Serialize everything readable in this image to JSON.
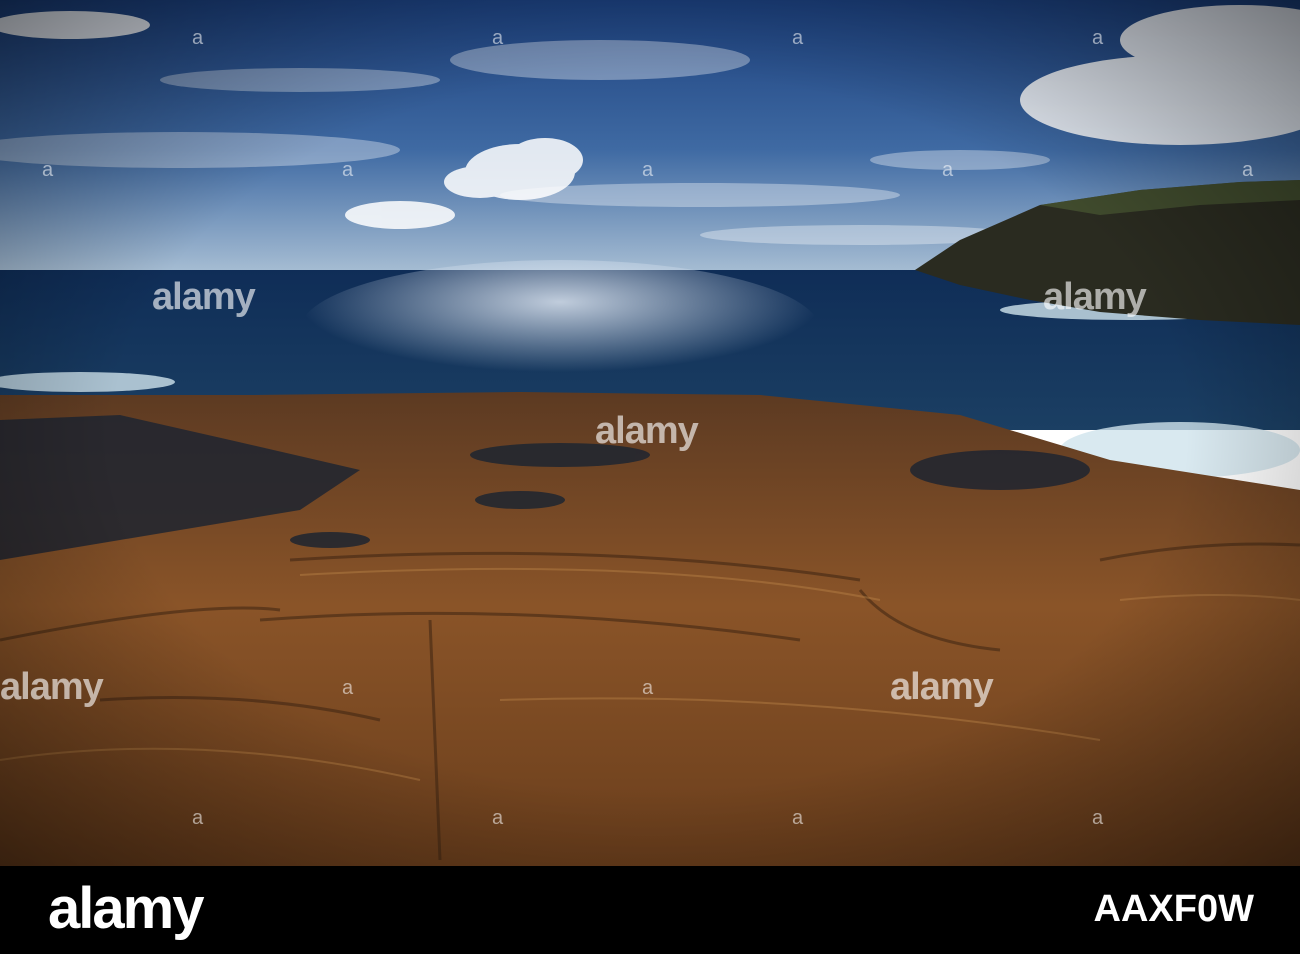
{
  "watermark": {
    "brand": "alamy",
    "small_mark": "a"
  },
  "footer": {
    "brand": "alamy",
    "image_code": "AAXF0W"
  },
  "scene": {
    "description_colors": {
      "sky_top": "#1f4a8c",
      "sky_horizon": "#9fb6cf",
      "ocean": "#0e2a52",
      "rock": "#7a4a22",
      "bar": "#000000"
    }
  }
}
